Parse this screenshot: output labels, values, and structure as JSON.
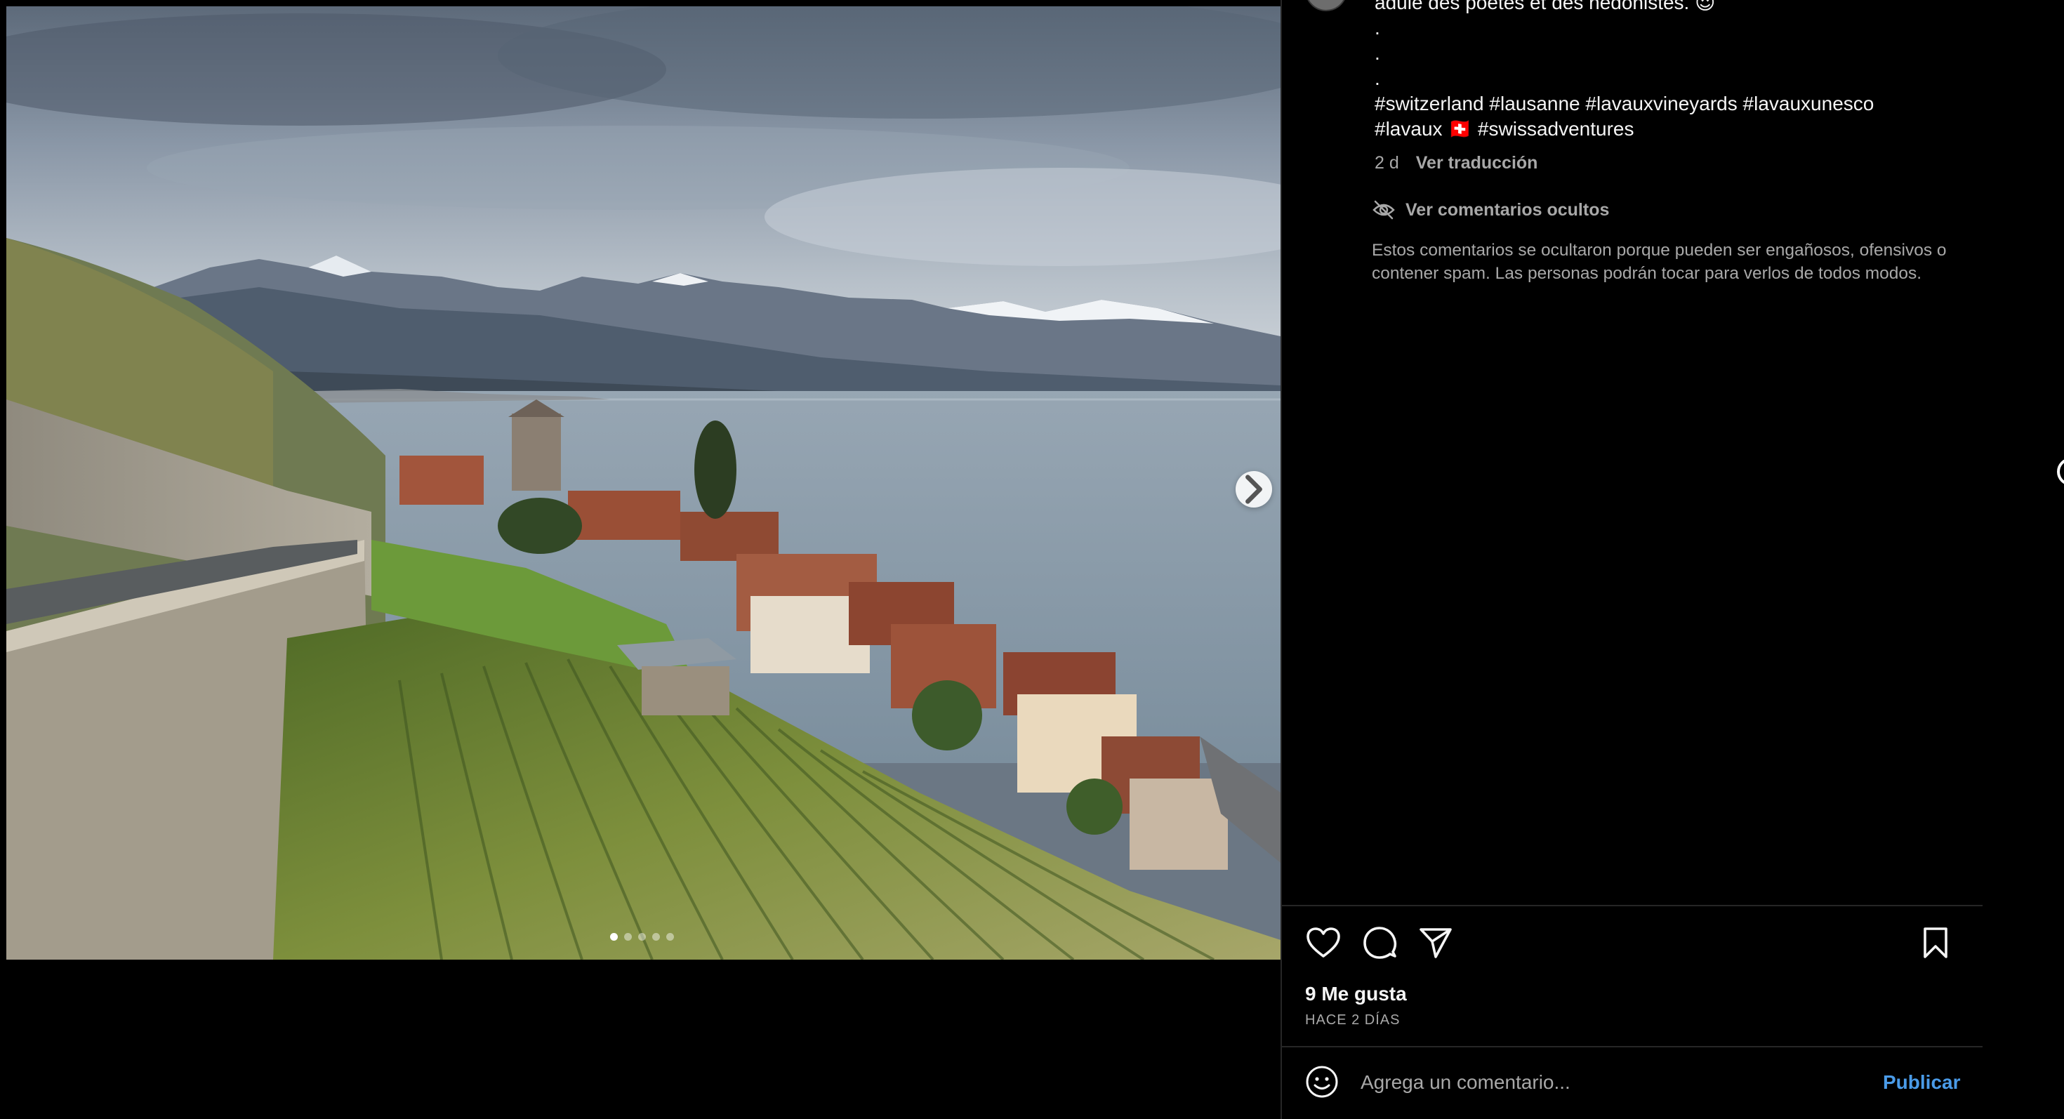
{
  "post": {
    "image_alt": "Lavaux vineyards overlooking Lake Geneva",
    "carousel": {
      "total": 5,
      "active": 0
    },
    "caption_lines": [
      "adulé des poètes et des hédonistes. 😍",
      ".",
      ".",
      ".",
      "#switzerland #lausanne #lavauxvineyards #lavauxunesco",
      "#lavaux 🇨🇭 #swissadventures"
    ],
    "age": "2 d",
    "translate_label": "Ver traducción",
    "hidden_comments_label": "Ver comentarios ocultos",
    "hidden_comments_note": "Estos comentarios se ocultaron porque pueden ser engañosos, ofensivos o contener spam. Las personas podrán tocar para verlos de todos modos.",
    "likes_label": "9 Me gusta",
    "time_ago": "HACE 2 DÍAS",
    "comment_placeholder": "Agrega un comentario...",
    "publish_label": "Publicar"
  },
  "icons": {
    "like": "heart-icon",
    "comment": "comment-icon",
    "share": "send-icon",
    "save": "bookmark-icon",
    "emoji": "smiley-icon",
    "hidden": "eye-off-icon",
    "next": "chevron-right-icon"
  },
  "colors": {
    "background": "#000000",
    "text": "#f5f5f5",
    "secondary_text": "#a8a8a8",
    "divider": "#262626",
    "link": "#4a9be8"
  }
}
